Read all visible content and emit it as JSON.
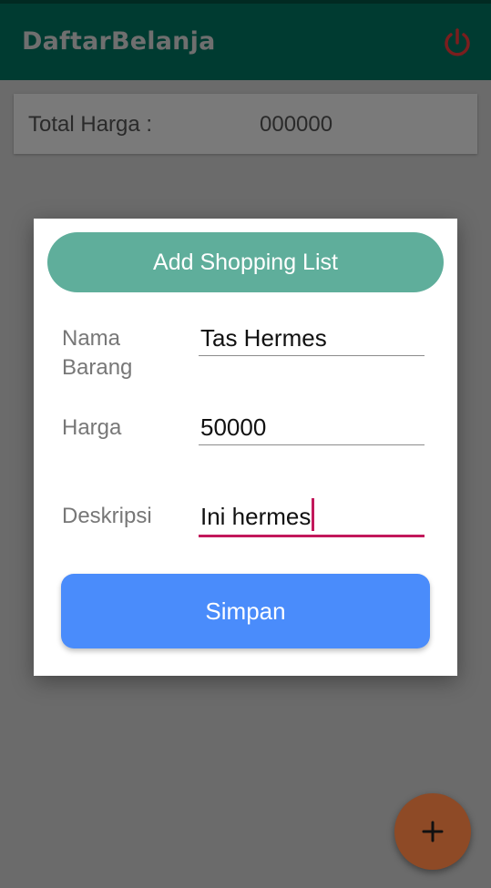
{
  "app": {
    "title": "DaftarBelanja"
  },
  "total": {
    "label": "Total Harga :",
    "value": "000000"
  },
  "dialog": {
    "title": "Add Shopping List",
    "fields": {
      "nama": {
        "label_line1": "Nama",
        "label_line2": "Barang",
        "value": "Tas Hermes"
      },
      "harga": {
        "label": "Harga",
        "value": "50000"
      },
      "deskripsi": {
        "label": "Deskripsi",
        "value": "Ini hermes"
      }
    },
    "save_label": "Simpan"
  },
  "fab": {
    "icon": "plus-icon"
  },
  "colors": {
    "appbar": "#003b31",
    "dialog_header": "#5fae9b",
    "save_button": "#4a8cfb",
    "focus_underline": "#c2185b",
    "fab": "#8e4a26",
    "power_icon": "#7a1e1e"
  }
}
